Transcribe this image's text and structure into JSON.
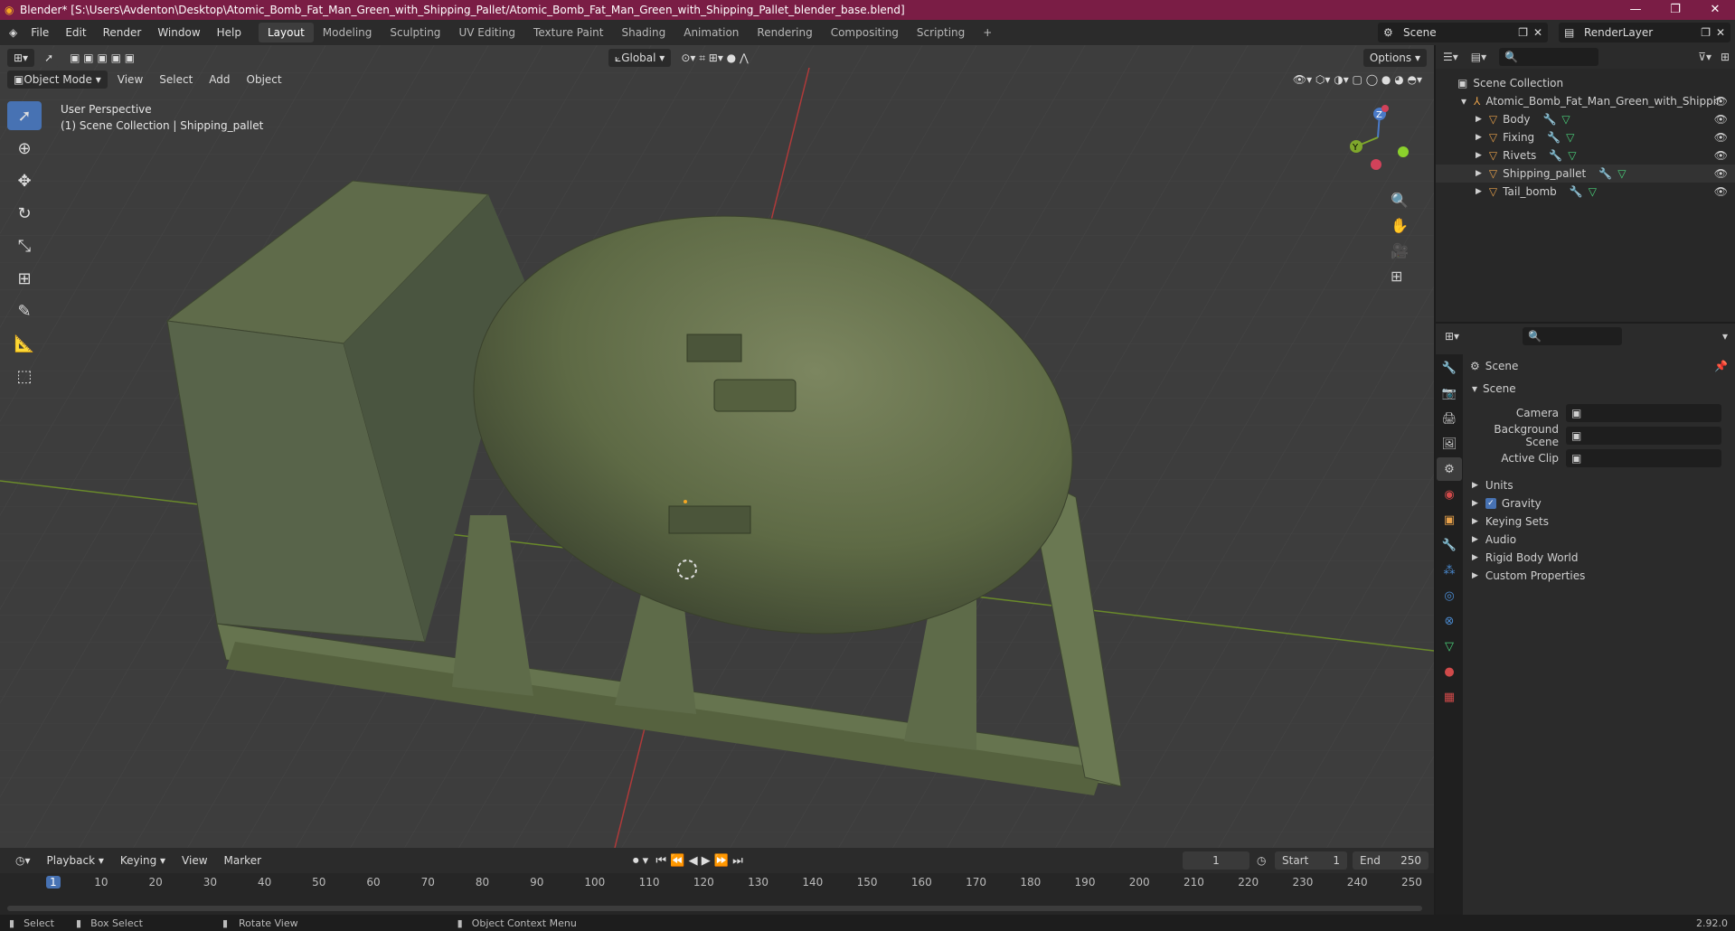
{
  "window": {
    "title": "Blender* [S:\\Users\\Avdenton\\Desktop\\Atomic_Bomb_Fat_Man_Green_with_Shipping_Pallet/Atomic_Bomb_Fat_Man_Green_with_Shipping_Pallet_blender_base.blend]",
    "minimize": "—",
    "maximize": "❐",
    "close": "✕"
  },
  "menu": [
    "File",
    "Edit",
    "Render",
    "Window",
    "Help"
  ],
  "workspaces": [
    "Layout",
    "Modeling",
    "Sculpting",
    "UV Editing",
    "Texture Paint",
    "Shading",
    "Animation",
    "Rendering",
    "Compositing",
    "Scripting"
  ],
  "active_workspace": "Layout",
  "add_workspace": "+",
  "scene_name": "Scene",
  "view_layer": "RenderLayer",
  "viewport": {
    "mode": "Object Mode",
    "menus": [
      "View",
      "Select",
      "Add",
      "Object"
    ],
    "transform_orientation": "Global",
    "options": "Options",
    "perspective_label": "User Perspective",
    "collection_label": "(1) Scene Collection | Shipping_pallet",
    "gizmo": {
      "x": "X",
      "y": "Y",
      "z": "Z"
    }
  },
  "outliner": {
    "root": "Scene Collection",
    "collection": "Atomic_Bomb_Fat_Man_Green_with_Shippir",
    "objects": [
      "Body",
      "Fixing",
      "Rivets",
      "Shipping_pallet",
      "Tail_bomb"
    ]
  },
  "properties": {
    "header": "Scene",
    "panel": "Scene",
    "fields": [
      {
        "label": "Camera"
      },
      {
        "label": "Background Scene"
      },
      {
        "label": "Active Clip"
      }
    ],
    "sections": [
      "Units",
      "Gravity",
      "Keying Sets",
      "Audio",
      "Rigid Body World",
      "Custom Properties"
    ],
    "gravity_checked": true
  },
  "timeline": {
    "menus": [
      "Playback",
      "Keying",
      "View",
      "Marker"
    ],
    "current_frame": "1",
    "start_label": "Start",
    "start": "1",
    "end_label": "End",
    "end": "250",
    "ticks": [
      "1",
      "10",
      "20",
      "30",
      "40",
      "50",
      "60",
      "70",
      "80",
      "90",
      "100",
      "110",
      "120",
      "130",
      "140",
      "150",
      "160",
      "170",
      "180",
      "190",
      "200",
      "210",
      "220",
      "230",
      "240",
      "250"
    ]
  },
  "status": {
    "select": "Select",
    "box_select": "Box Select",
    "rotate": "Rotate View",
    "context": "Object Context Menu",
    "version": "2.92.0"
  },
  "colors": {
    "title": "#7a1d45",
    "accent": "#4772b3",
    "bomb": "#5e6a45",
    "pallet": "#69775a"
  }
}
